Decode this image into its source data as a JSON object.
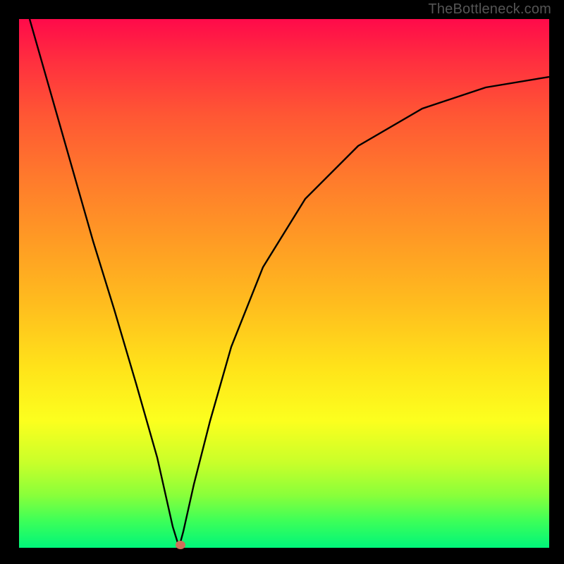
{
  "watermark": "TheBottleneck.com",
  "chart_data": {
    "type": "line",
    "title": "",
    "xlabel": "",
    "ylabel": "",
    "xlim": [
      0,
      100
    ],
    "ylim": [
      0,
      100
    ],
    "series": [
      {
        "name": "curve",
        "x": [
          2,
          6,
          10,
          14,
          18,
          22,
          26,
          29,
          30,
          31,
          33,
          36,
          40,
          46,
          54,
          64,
          76,
          88,
          100
        ],
        "y": [
          100,
          86,
          72,
          58,
          45,
          31,
          17,
          4,
          0,
          3,
          12,
          24,
          38,
          53,
          66,
          76,
          83,
          87,
          89
        ]
      }
    ],
    "marker": {
      "x": 30.5,
      "y": 0.5
    },
    "background_gradient": {
      "top": "#ff0a4a",
      "bottom": "#00f57a"
    }
  }
}
